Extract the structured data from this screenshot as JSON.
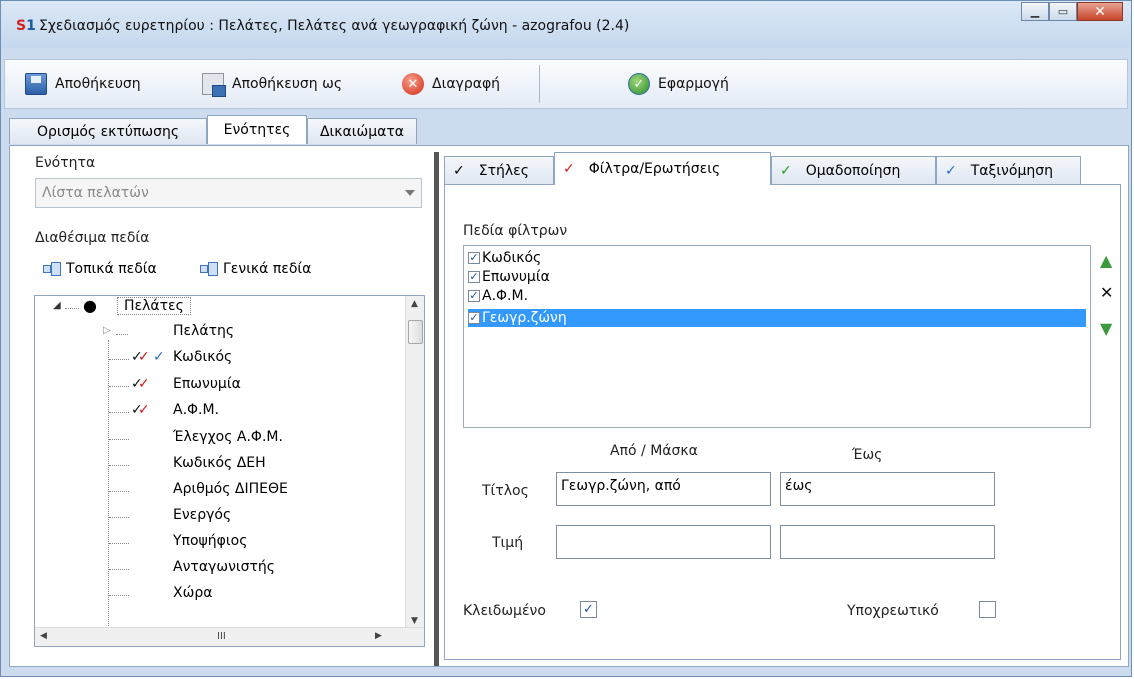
{
  "window": {
    "app_icon": "S1",
    "title": "Σχεδιασμός ευρετηρίου : Πελάτες, Πελάτες ανά γεωγραφική ζώνη - azografou (2.4)",
    "buttons": {
      "minimize": "minimize-icon",
      "maximize": "maximize-icon",
      "close": "close-icon"
    }
  },
  "toolbar": {
    "save_label": "Αποθήκευση",
    "save_as_label": "Αποθήκευση ως",
    "delete_label": "Διαγραφή",
    "apply_label": "Εφαρμογή"
  },
  "top_tabs": [
    {
      "label": "Ορισμός εκτύπωσης",
      "active": false
    },
    {
      "label": "Ενότητες",
      "active": true
    },
    {
      "label": "Δικαιώματα",
      "active": false
    }
  ],
  "left": {
    "section_label": "Ενότητα",
    "section_value": "Λίστα πελατών",
    "available_fields_label": "Διαθέσιμα πεδία",
    "local_fields_label": "Τοπικά πεδία",
    "general_fields_label": "Γενικά πεδία",
    "tree": {
      "root": "Πελάτες",
      "group": "Πελάτης",
      "items": [
        {
          "label": "Κωδικός",
          "marks": "blk-red-blu"
        },
        {
          "label": "Επωνυμία",
          "marks": "blk-red"
        },
        {
          "label": "Α.Φ.Μ.",
          "marks": "blk-red"
        },
        {
          "label": "Έλεγχος Α.Φ.Μ.",
          "marks": ""
        },
        {
          "label": "Κωδικός ΔΕΗ",
          "marks": ""
        },
        {
          "label": "Αριθμός ΔΙΠΕΘΕ",
          "marks": ""
        },
        {
          "label": "Ενεργός",
          "marks": ""
        },
        {
          "label": "Υποψήφιος",
          "marks": ""
        },
        {
          "label": "Ανταγωνιστής",
          "marks": ""
        },
        {
          "label": "Χώρα",
          "marks": ""
        }
      ],
      "check_marks": {
        "black": "✓",
        "red": "✓",
        "blue": "✓"
      },
      "h_scroll_mid": "III"
    }
  },
  "right": {
    "tabs": [
      {
        "label": "Στήλες",
        "check": "✓",
        "check_color": "#000000",
        "active": false
      },
      {
        "label": "Φίλτρα/Ερωτήσεις",
        "check": "✓",
        "check_color": "#d21b1b",
        "active": true
      },
      {
        "label": "Ομαδοποίηση",
        "check": "✓",
        "check_color": "#22a022",
        "active": false
      },
      {
        "label": "Ταξινόμηση",
        "check": "✓",
        "check_color": "#2a6bd0",
        "active": false
      }
    ],
    "filter_fields_label": "Πεδία φίλτρων",
    "filter_fields": [
      {
        "label": "Κωδικός",
        "checked": true,
        "selected": false
      },
      {
        "label": "Επωνυμία",
        "checked": true,
        "selected": false
      },
      {
        "label": "Α.Φ.Μ.",
        "checked": true,
        "selected": false
      },
      {
        "label": "Γεωγρ.ζώνη",
        "checked": true,
        "selected": true
      }
    ],
    "side_icons": {
      "up": "up-arrow-icon",
      "remove": "remove-icon",
      "down": "down-arrow-icon"
    },
    "from_mask_label": "Από / Μάσκα",
    "to_label": "Έως",
    "title_label": "Τίτλος",
    "title_from_value": "Γεωγρ.ζώνη, από",
    "title_to_value": "έως",
    "value_label": "Τιμή",
    "value_from": "",
    "value_to": "",
    "locked_label": "Κλειδωμένο",
    "locked_checked": true,
    "required_label": "Υποχρεωτικό",
    "required_checked": false
  }
}
